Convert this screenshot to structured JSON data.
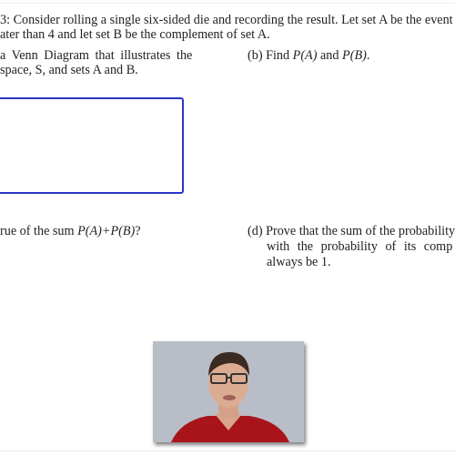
{
  "problem": {
    "line1": "3: Consider rolling a single six-sided die and recording the result. Let set A be the event",
    "line2": "ater than 4 and let set B be the complement of set A."
  },
  "part_a": {
    "line1": "a  Venn  Diagram  that  illustrates  the",
    "line2": "space, S, and sets A and B."
  },
  "part_b": {
    "label": "(b) Find ",
    "pa": "P(A)",
    "and": " and ",
    "pb": "P(B)",
    "end": "."
  },
  "part_c": {
    "text": "rue of the sum ",
    "expr": "P(A)+P(B)",
    "end": "?"
  },
  "part_d": {
    "line1": "(d) Prove that the sum of the probability",
    "line2": "with  the  probability  of  its  comp",
    "line3": "always be 1."
  },
  "colors": {
    "venn_box": "#2b35c8"
  }
}
